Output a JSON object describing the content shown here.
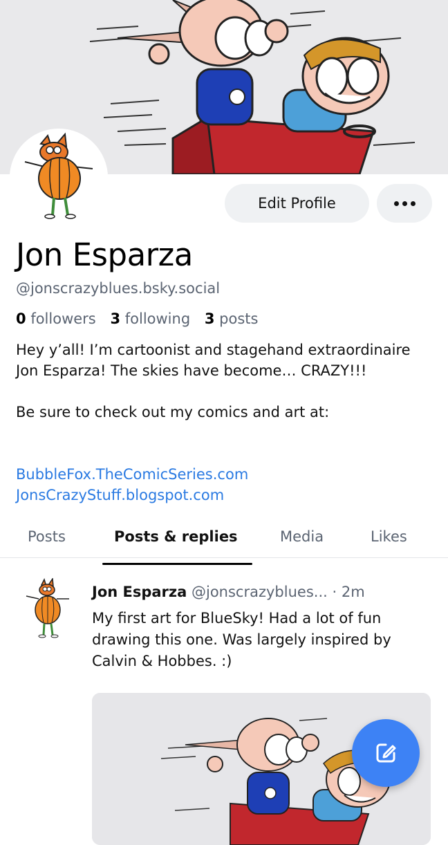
{
  "profile": {
    "name": "Jon Esparza",
    "handle": "@jonscrazyblues.bsky.social",
    "stats": {
      "followers_count": "0",
      "followers_label": "followers",
      "following_count": "3",
      "following_label": "following",
      "posts_count": "3",
      "posts_label": "posts"
    },
    "bio": [
      "Hey y’all! I’m cartoonist and stagehand extraordinaire Jon Esparza! The skies have become… CRAZY!!!",
      "Be sure to check out my comics and art at:"
    ],
    "links": [
      "BubbleFox.TheComicSeries.com",
      "JonsCrazyStuff.blogspot.com"
    ]
  },
  "actions": {
    "edit_profile_label": "Edit Profile",
    "more_icon": "ellipsis-icon"
  },
  "tabs": [
    {
      "label": "Posts",
      "active": false
    },
    {
      "label": "Posts & replies",
      "active": true
    },
    {
      "label": "Media",
      "active": false
    },
    {
      "label": "Likes",
      "active": false
    }
  ],
  "post": {
    "author_name": "Jon Esparza",
    "author_handle": "@jonscrazyblues...",
    "separator": "·",
    "time": "2m",
    "text": "My first art for BlueSky! Had a lot of fun drawing this one. Was largely inspired by Calvin & Hobbes. :)"
  },
  "fab": {
    "icon": "compose-icon"
  },
  "colors": {
    "link": "#2a7ae2",
    "fab": "#3d82f5",
    "button_bg": "#eff1f3",
    "muted_text": "#5b6472"
  }
}
